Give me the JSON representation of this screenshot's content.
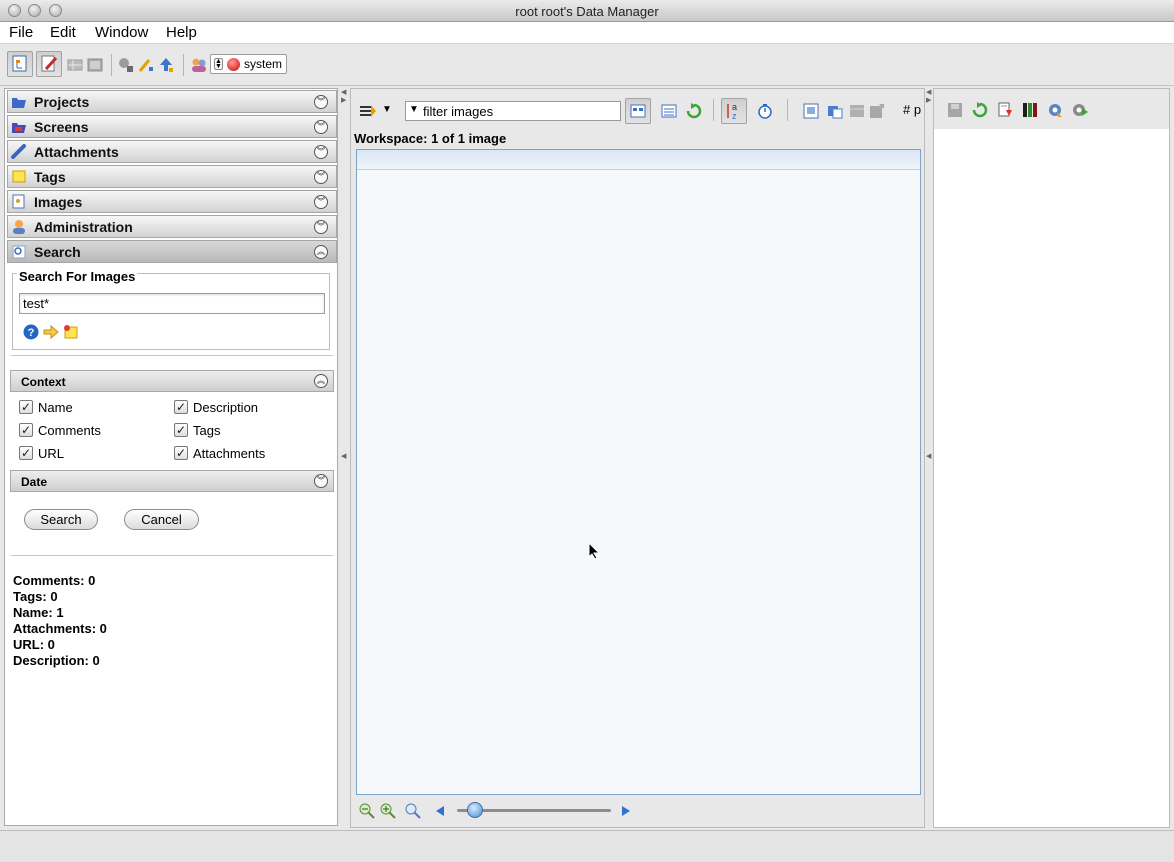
{
  "window": {
    "title": "root root's Data Manager"
  },
  "menu": {
    "file": "File",
    "edit": "Edit",
    "window": "Window",
    "help": "Help"
  },
  "toolbar": {
    "group_name": "system"
  },
  "accordion": {
    "projects": "Projects",
    "screens": "Screens",
    "attachments": "Attachments",
    "tags": "Tags",
    "images": "Images",
    "administration": "Administration",
    "search": "Search"
  },
  "search": {
    "section_title": "Search For Images",
    "query": "test*",
    "context_label": "Context",
    "date_label": "Date",
    "context": {
      "name": "Name",
      "description": "Description",
      "comments": "Comments",
      "tags": "Tags",
      "url": "URL",
      "attachments": "Attachments"
    },
    "search_button": "Search",
    "cancel_button": "Cancel",
    "results": {
      "comments": "Comments: 0",
      "tags": "Tags: 0",
      "name": "Name: 1",
      "attachments": "Attachments: 0",
      "url": "URL: 0",
      "description": "Description: 0"
    }
  },
  "center": {
    "filter_text": "filter  images",
    "workspace_label": "Workspace: 1 of 1 image",
    "truncated_label": "# p",
    "zoom_level": 0.12
  },
  "colors": {
    "grid_border": "#7ea3c4",
    "grid_bg": "#f5f9fc",
    "accent_blue": "#3b6ea5"
  }
}
